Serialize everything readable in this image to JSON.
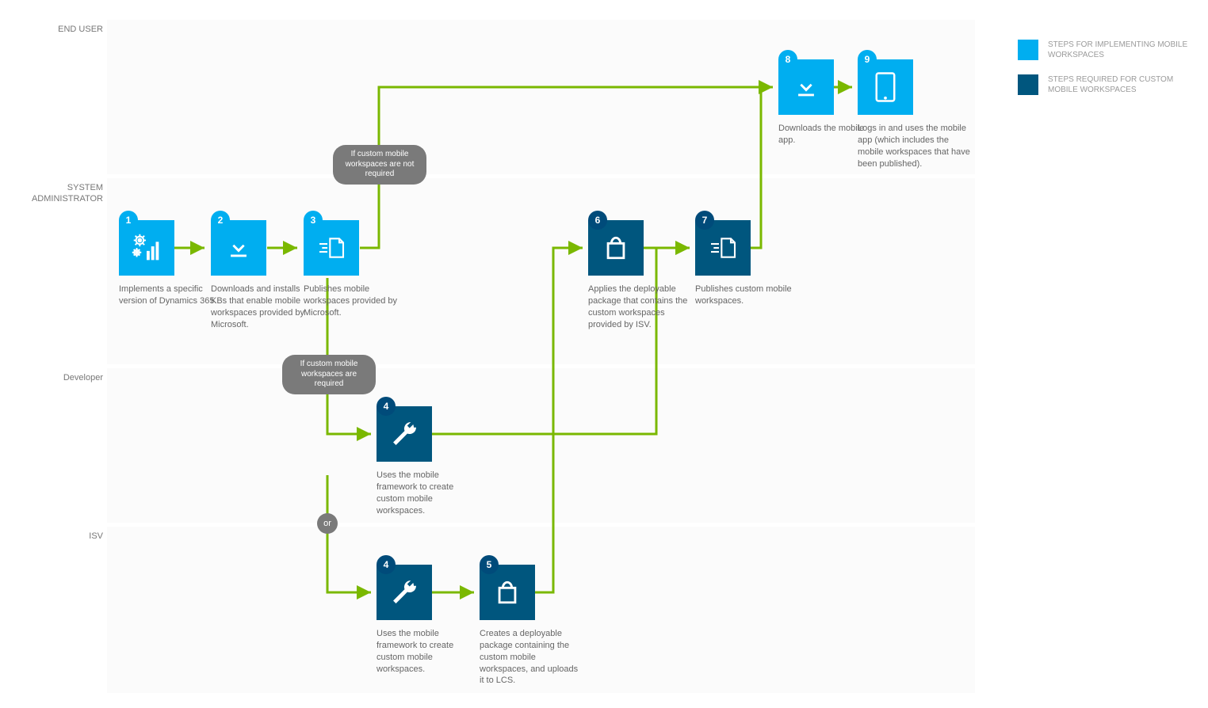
{
  "lanes": {
    "endUser": "END USER",
    "sysAdmin": "SYSTEM\nADMINISTRATOR",
    "developer": "Developer",
    "isv": "ISV"
  },
  "steps": {
    "s1": {
      "num": "1",
      "text": "Implements a specific version of Dynamics 365."
    },
    "s2": {
      "num": "2",
      "text": "Downloads and installs KBs that enable mobile workspaces provided by Microsoft."
    },
    "s3": {
      "num": "3",
      "text": "Publishes mobile workspaces provided by Microsoft."
    },
    "s4a": {
      "num": "4",
      "text": "Uses the mobile framework to create custom mobile workspaces."
    },
    "s4b": {
      "num": "4",
      "text": "Uses the mobile framework to create custom mobile workspaces."
    },
    "s5": {
      "num": "5",
      "text": "Creates a deployable package containing the custom mobile workspaces, and uploads it to LCS."
    },
    "s6": {
      "num": "6",
      "text": "Applies the deployable package that contains the custom workspaces provided by ISV."
    },
    "s7": {
      "num": "7",
      "text": "Publishes custom mobile workspaces."
    },
    "s8": {
      "num": "8",
      "text": "Downloads the mobile app."
    },
    "s9": {
      "num": "9",
      "text": "Logs in and uses the mobile app (which includes the mobile workspaces that have been published)."
    }
  },
  "decisions": {
    "notRequired": "If custom mobile workspaces are not required",
    "required": "If custom mobile workspaces are required",
    "or": "or"
  },
  "legend": {
    "implementing": "STEPS FOR IMPLEMENTING MOBILE WORKSPACES",
    "custom": "STEPS REQUIRED FOR CUSTOM MOBILE WORKSPACES"
  }
}
